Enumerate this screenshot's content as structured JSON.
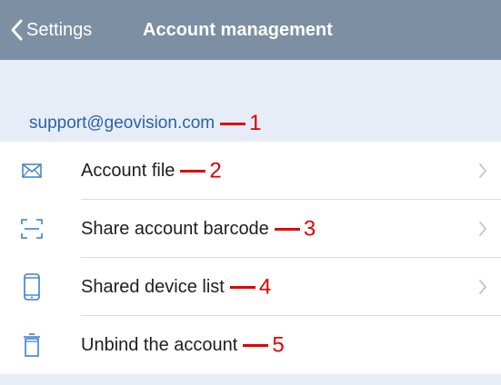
{
  "navbar": {
    "back_label": "Settings",
    "title": "Account management",
    "background_color": "#7d8fa3",
    "back_icon": "chevron-left-icon"
  },
  "account": {
    "email": "support@geovision.com",
    "annotation": "1"
  },
  "rows": [
    {
      "label": "Account file",
      "icon": "envelope-icon",
      "annotation": "2",
      "has_chevron": true
    },
    {
      "label": "Share account barcode",
      "icon": "barcode-scan-icon",
      "annotation": "3",
      "has_chevron": true
    },
    {
      "label": "Shared device list",
      "icon": "phone-icon",
      "annotation": "4",
      "has_chevron": true
    },
    {
      "label": "Unbind the account",
      "icon": "trash-icon",
      "annotation": "5",
      "has_chevron": false
    }
  ],
  "colors": {
    "accent": "#2a63a8",
    "annotation": "#e00000",
    "section_background": "#e7edf6"
  }
}
